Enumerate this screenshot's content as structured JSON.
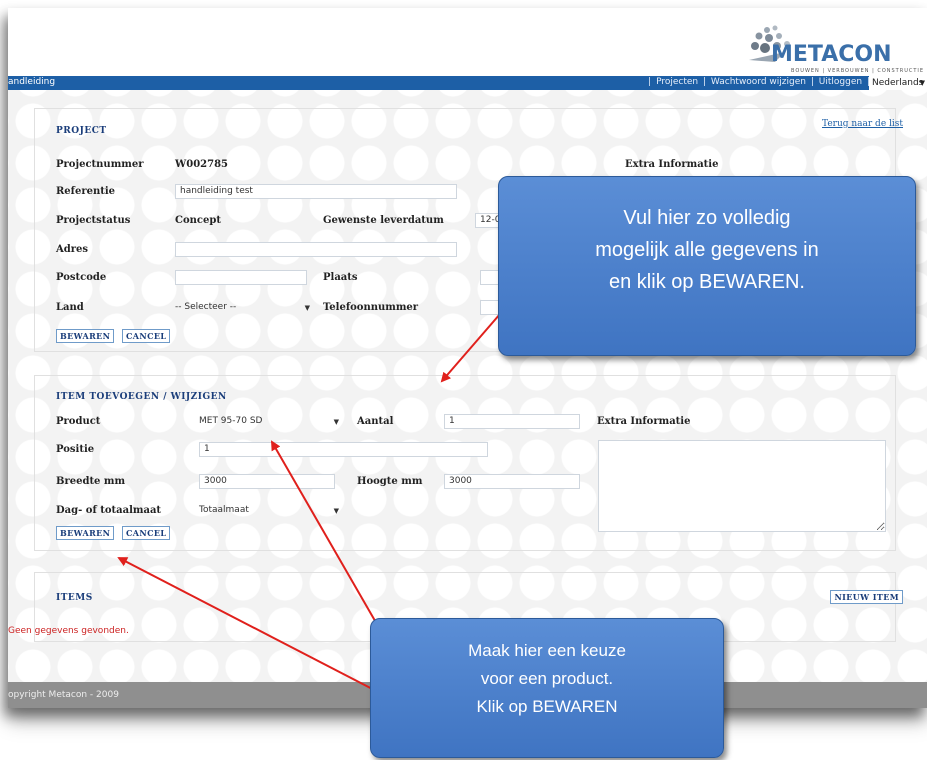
{
  "navbar": {
    "left_label": "andleiding",
    "links": [
      "Projecten",
      "Wachtwoord wijzigen",
      "Uitloggen"
    ],
    "separator": "|",
    "language": "Nederlands"
  },
  "logo": {
    "text": "METACON",
    "tagline": "BOUWEN | VERBOUWEN | CONSTRUCTIE"
  },
  "project": {
    "title": "PROJECT",
    "back_link": "Terug naar de list",
    "projectnummer_label": "Projectnummer",
    "projectnummer_value": "W002785",
    "extra_info_label": "Extra Informatie",
    "referentie_label": "Referentie",
    "referentie_value": "handleiding test",
    "projectstatus_label": "Projectstatus",
    "projectstatus_value": "Concept",
    "leverdatum_label": "Gewenste leverdatum",
    "leverdatum_value": "12-0",
    "adres_label": "Adres",
    "adres_value": "",
    "postcode_label": "Postcode",
    "postcode_value": "",
    "plaats_label": "Plaats",
    "plaats_value": "",
    "land_label": "Land",
    "land_value": "-- Selecteer --",
    "telefoon_label": "Telefoonnummer",
    "telefoon_value": "",
    "save_label": "BEWAREN",
    "cancel_label": "CANCEL"
  },
  "item": {
    "title": "ITEM TOEVOEGEN / WIJZIGEN",
    "product_label": "Product",
    "product_value": "MET 95-70 SD",
    "aantal_label": "Aantal",
    "aantal_value": "1",
    "extra_info_label": "Extra Informatie",
    "positie_label": "Positie",
    "positie_value": "1",
    "breedte_label": "Breedte mm",
    "breedte_value": "3000",
    "hoogte_label": "Hoogte mm",
    "hoogte_value": "3000",
    "maat_label": "Dag- of totaalmaat",
    "maat_value": "Totaalmaat",
    "save_label": "BEWAREN",
    "cancel_label": "CANCEL"
  },
  "items": {
    "title": "ITEMS",
    "new_item_label": "NIEUW ITEM",
    "empty_message": "Geen gegevens gevonden."
  },
  "footer": {
    "copyright": "opyright Metacon - 2009"
  },
  "callouts": {
    "top": [
      "Vul hier zo volledig",
      "mogelijk alle gegevens in",
      "en klik op BEWAREN."
    ],
    "bottom": [
      "Maak hier een keuze",
      "voor een product.",
      "Klik op BEWAREN"
    ]
  },
  "colors": {
    "navbar": "#1d5fa6",
    "callout": "#4a80cc",
    "arrow": "#e0201c",
    "error_text": "#cc2222",
    "footer": "#8f8f8f"
  }
}
